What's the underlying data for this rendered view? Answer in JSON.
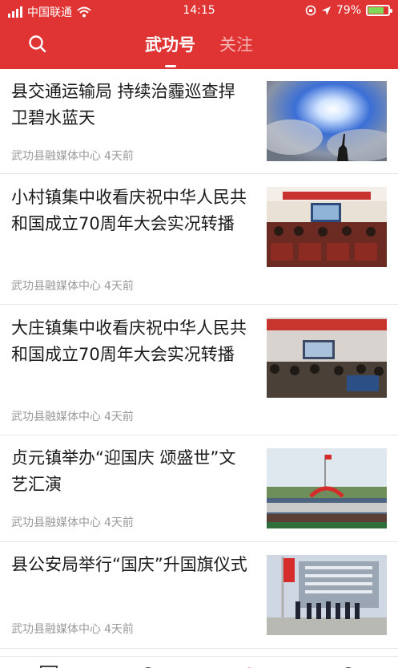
{
  "status_bar": {
    "carrier": "中国联通",
    "time": "14:15",
    "battery": "79%",
    "battery_level": 0.79,
    "icons": [
      "signal-icon",
      "wifi-icon",
      "orientation-lock-icon",
      "location-icon",
      "battery-icon"
    ]
  },
  "header": {
    "tabs": [
      {
        "label": "武功号",
        "active": true
      },
      {
        "label": "关注",
        "active": false
      }
    ],
    "colors": {
      "bar": "#e03434",
      "active_tab": "#ffffff",
      "inactive_tab": "#f5b5b5"
    }
  },
  "feed": {
    "items": [
      {
        "title": "县交通运输局 持续治霾巡查捍卫碧水蓝天",
        "source": "武功县融媒体中心",
        "time": "4天前",
        "image": "sky-photo"
      },
      {
        "title": "小村镇集中收看庆祝中华人民共和国成立70周年大会实况转播",
        "source": "武功县融媒体中心",
        "time": "4天前",
        "image": "meeting-hall-photo"
      },
      {
        "title": "大庄镇集中收看庆祝中华人民共和国成立70周年大会实况转播",
        "source": "武功县融媒体中心",
        "time": "4天前",
        "image": "meeting-room-photo"
      },
      {
        "title": "贞元镇举办“迎国庆 颂盛世”文艺汇演",
        "source": "武功县融媒体中心",
        "time": "4天前",
        "image": "outdoor-performance-photo"
      },
      {
        "title": "县公安局举行“国庆”升国旗仪式",
        "source": "武功县融媒体中心",
        "time": "4天前",
        "image": "flag-raising-photo"
      }
    ]
  }
}
